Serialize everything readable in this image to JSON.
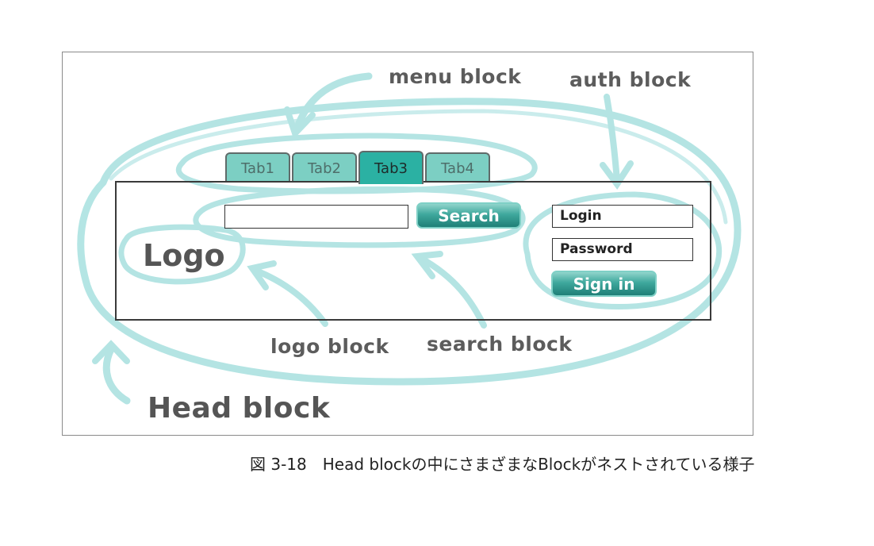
{
  "labels": {
    "menu_block": "menu block",
    "auth_block": "auth block",
    "logo_block": "logo block",
    "search_block": "search block",
    "head_block": "Head block"
  },
  "tabs": [
    {
      "label": "Tab1",
      "active": false
    },
    {
      "label": "Tab2",
      "active": false
    },
    {
      "label": "Tab3",
      "active": true
    },
    {
      "label": "Tab4",
      "active": false
    }
  ],
  "header": {
    "logo": "Logo",
    "search_button": "Search",
    "search_value": "",
    "login_field": "Login",
    "password_field": "Password",
    "signin_button": "Sign in"
  },
  "caption": "図 3-18　Head blockの中にさまざまなBlockがネストされている様子",
  "colors": {
    "highlight_stroke": "#9ddcdc",
    "tab_inactive": "#7ccfc3",
    "tab_active": "#2bb1a3",
    "button_teal": "#2f968c"
  }
}
